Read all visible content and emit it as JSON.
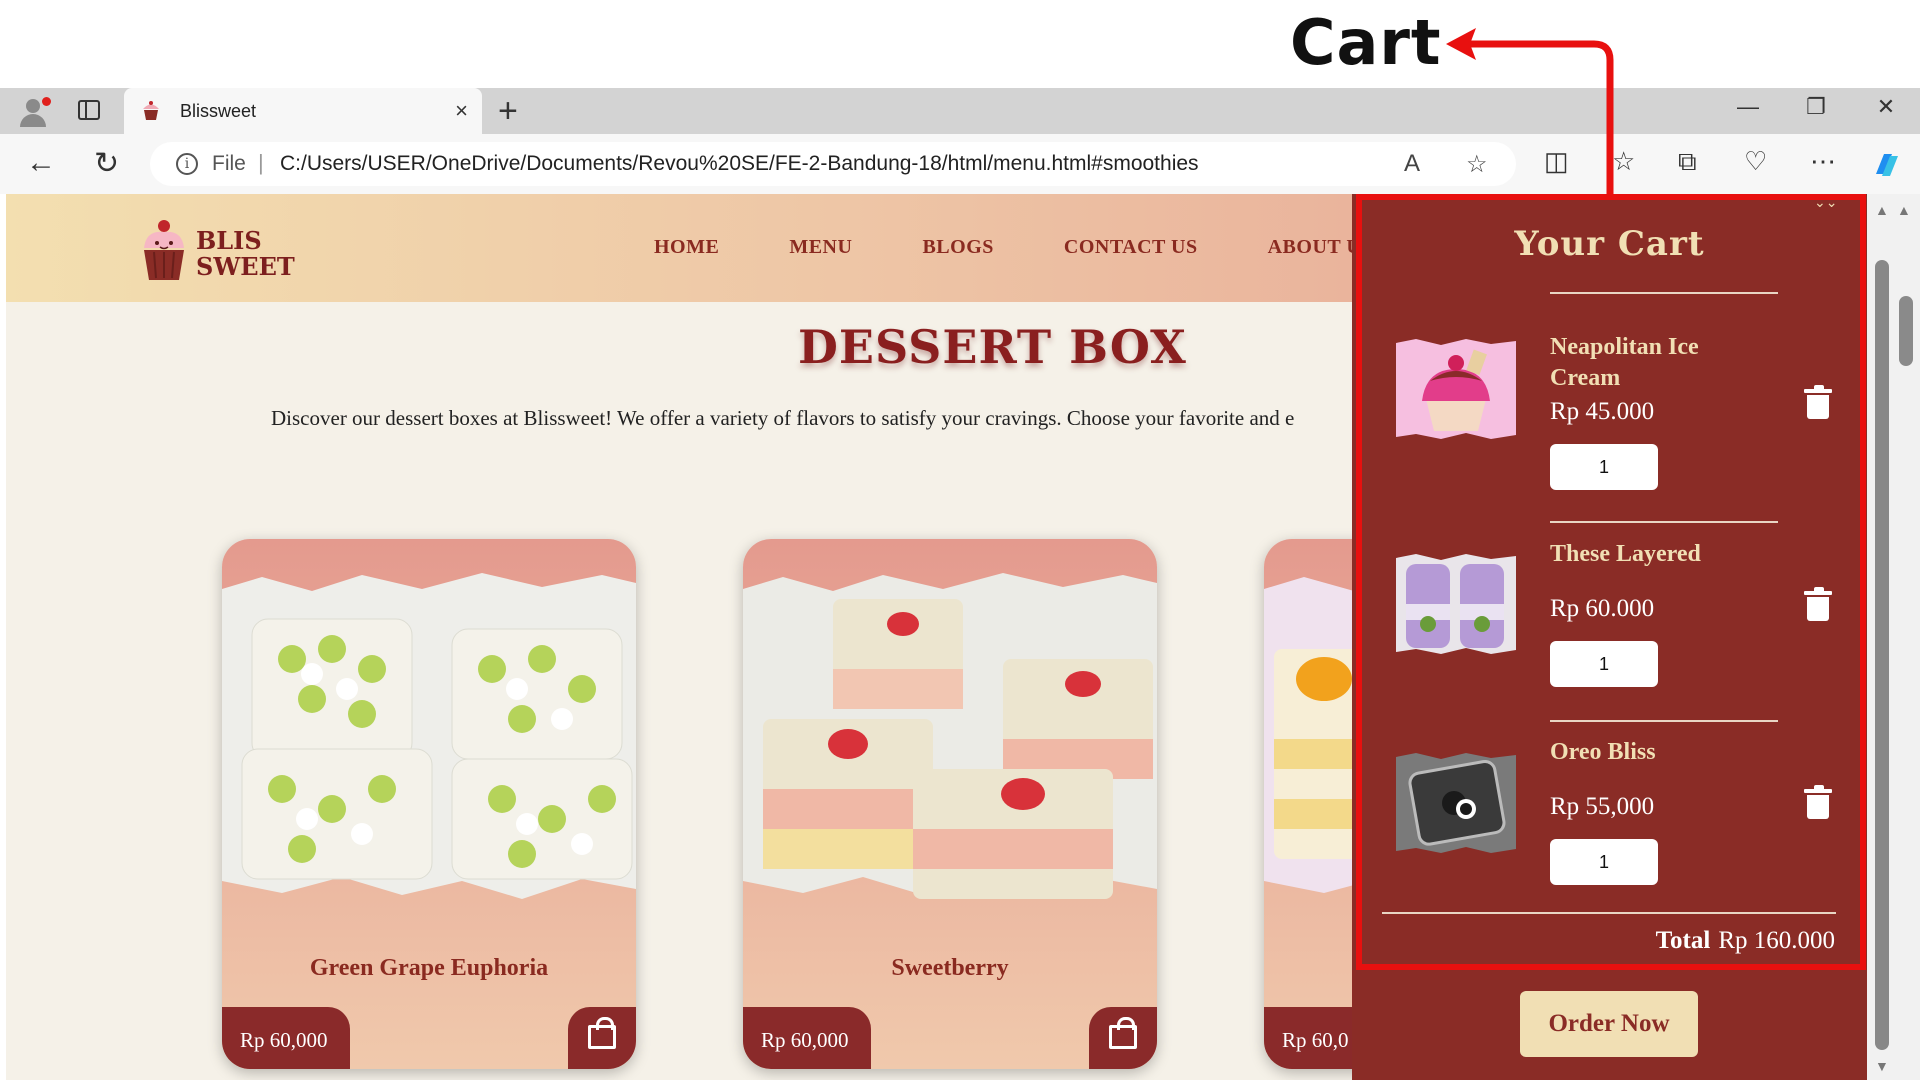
{
  "annotation": {
    "label": "Cart"
  },
  "browser": {
    "tab_title": "Blissweet",
    "url_scheme": "File",
    "url": "C:/Users/USER/OneDrive/Documents/Revou%20SE/FE-2-Bandung-18/html/menu.html#smoothies",
    "new_tab": "+",
    "tab_close": "×"
  },
  "site": {
    "logo_line1": "BLIS",
    "logo_line2": "SWEET",
    "nav": [
      "HOME",
      "MENU",
      "BLOGS",
      "CONTACT US",
      "ABOUT US"
    ]
  },
  "main": {
    "title": "DESSERT BOX",
    "description": "Discover our dessert boxes at Blissweet! We offer a variety of flavors to satisfy your cravings. Choose your favorite and e",
    "products": [
      {
        "name": "Green Grape Euphoria",
        "price": "Rp 60,000"
      },
      {
        "name": "Sweetberry",
        "price": "Rp 60,000"
      },
      {
        "name": "",
        "price": "Rp 60,0"
      }
    ]
  },
  "cart": {
    "title": "Your Cart",
    "items": [
      {
        "name": "Neapolitan Ice Cream",
        "price": "Rp 45.000",
        "qty": "1"
      },
      {
        "name": "These Layered",
        "price": "Rp 60.000",
        "qty": "1"
      },
      {
        "name": "Oreo Bliss",
        "price": "Rp 55,000",
        "qty": "1"
      }
    ],
    "total_label": "Total",
    "total_value": "Rp 160.000",
    "order_button": "Order Now"
  },
  "colors": {
    "accent": "#8a2c26",
    "cream": "#f1dfb4",
    "highlight": "#e8100f"
  }
}
